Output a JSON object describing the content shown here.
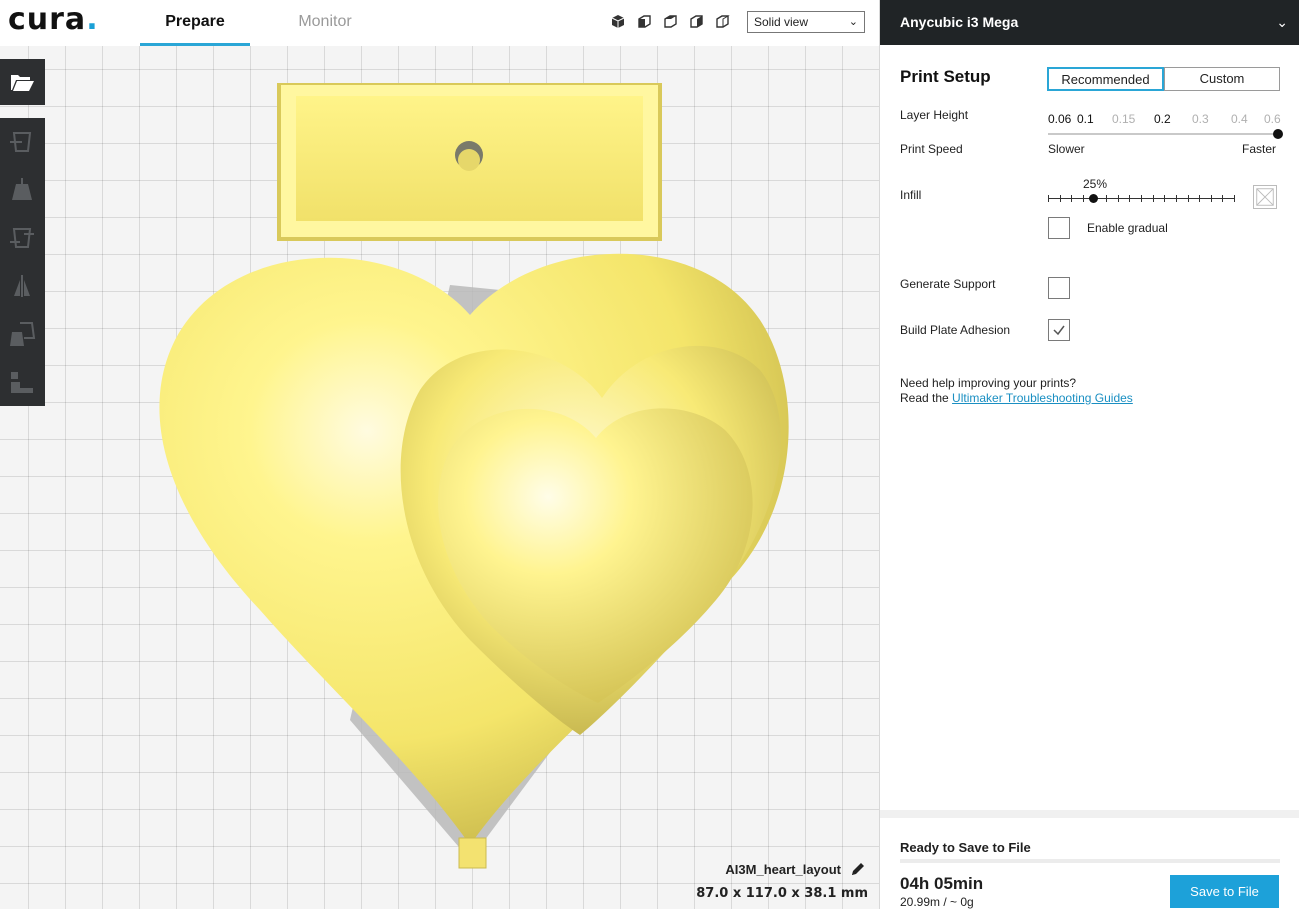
{
  "app": {
    "logo": "cura",
    "logo_dot": "."
  },
  "tabs": [
    {
      "label": "Prepare",
      "active": true
    },
    {
      "label": "Monitor",
      "active": false
    }
  ],
  "view": {
    "camera_icons": [
      "perspective-view-icon",
      "front-view-icon",
      "top-view-icon",
      "left-view-icon",
      "right-view-icon"
    ],
    "mode": "Solid view"
  },
  "tools": [
    "open-file-icon",
    "move-tool-icon",
    "scale-tool-icon",
    "rotate-tool-icon",
    "mirror-tool-icon",
    "per-model-settings-icon",
    "support-blocker-icon"
  ],
  "object": {
    "name": "AI3M_heart_layout",
    "dimensions": "87.0 x 117.0 x 38.1 mm"
  },
  "machine": {
    "name": "Anycubic i3 Mega"
  },
  "print_setup": {
    "title": "Print Setup",
    "modes": {
      "recommended": "Recommended",
      "custom": "Custom"
    },
    "layer_height": {
      "label": "Layer Height",
      "ticks": [
        "0.06",
        "0.1",
        "0.15",
        "0.2",
        "0.3",
        "0.4",
        "0.6"
      ],
      "selected": "0.6"
    },
    "print_speed": {
      "label": "Print Speed",
      "slower": "Slower",
      "faster": "Faster"
    },
    "infill": {
      "label": "Infill",
      "percent": "25%",
      "value": 25,
      "gradual_label": "Enable gradual",
      "gradual": false
    },
    "support": {
      "label": "Generate Support",
      "checked": false
    },
    "adhesion": {
      "label": "Build Plate Adhesion",
      "checked": true
    },
    "help": {
      "line1": "Need help improving your prints?",
      "line2_prefix": "Read the ",
      "link": "Ultimaker Troubleshooting Guides"
    }
  },
  "status": {
    "ready": "Ready to Save to File",
    "time": "04h 05min",
    "material": "20.99m / ~ 0g",
    "save_button": "Save to File"
  },
  "colors": {
    "accent": "#1da1d9",
    "model_yellow": "#fff27a",
    "toolbar": "#2d2f31",
    "machine_bar": "#202426"
  }
}
